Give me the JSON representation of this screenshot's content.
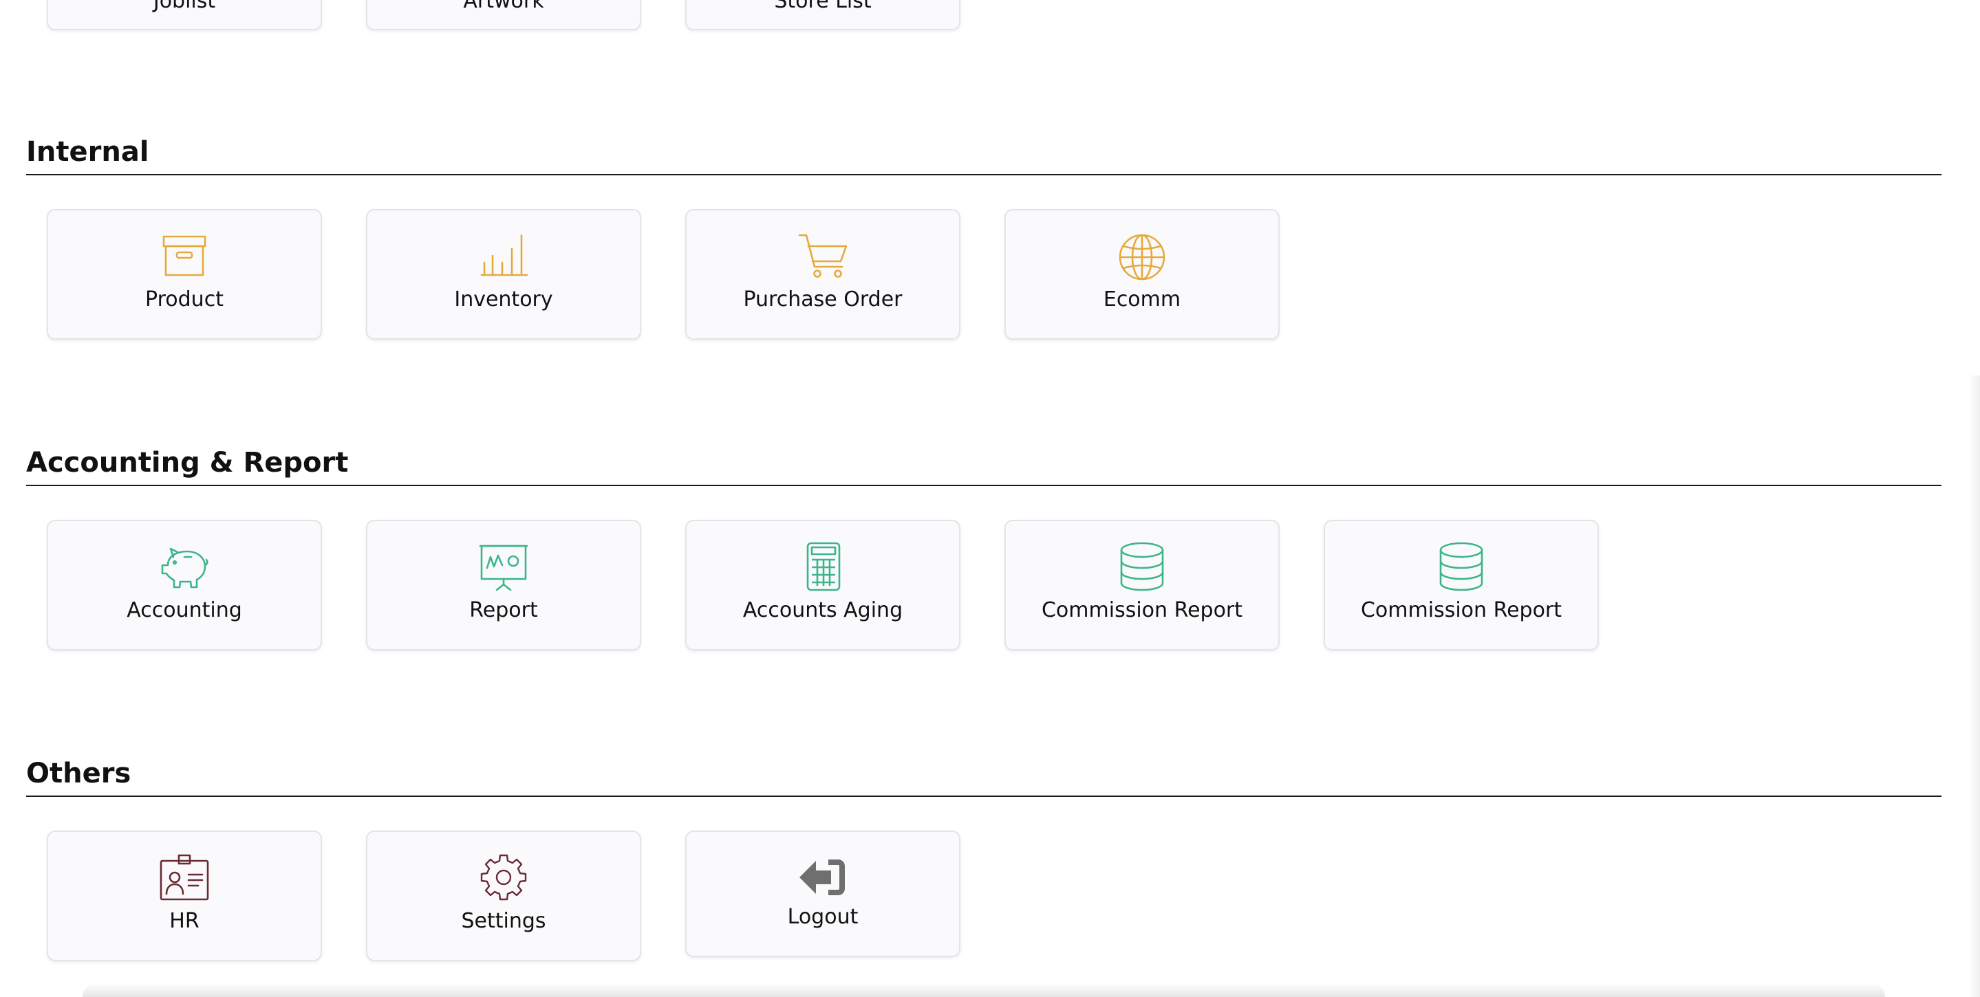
{
  "top_row": {
    "items": [
      {
        "label": "Joblist"
      },
      {
        "label": "Artwork"
      },
      {
        "label": "Store List"
      }
    ]
  },
  "sections": [
    {
      "title": "Internal",
      "accent": "#e8a93c",
      "items": [
        {
          "label": "Product",
          "icon": "archive-box-icon"
        },
        {
          "label": "Inventory",
          "icon": "bar-chart-icon"
        },
        {
          "label": "Purchase Order",
          "icon": "shopping-cart-icon"
        },
        {
          "label": "Ecomm",
          "icon": "globe-icon"
        }
      ]
    },
    {
      "title": "Accounting & Report",
      "accent": "#3bb58a",
      "items": [
        {
          "label": "Accounting",
          "icon": "piggy-bank-icon"
        },
        {
          "label": "Report",
          "icon": "presentation-board-icon"
        },
        {
          "label": "Accounts Aging",
          "icon": "calculator-icon"
        },
        {
          "label": "Commission Report",
          "icon": "coin-stack-icon"
        },
        {
          "label": "Commission Report",
          "icon": "coin-stack-icon"
        }
      ]
    },
    {
      "title": "Others",
      "accent": "#6b2a33",
      "items": [
        {
          "label": "HR",
          "icon": "id-badge-icon"
        },
        {
          "label": "Settings",
          "icon": "gear-icon"
        },
        {
          "label": "Logout",
          "icon": "logout-icon"
        }
      ]
    }
  ],
  "colors": {
    "logout_icon": "#6f6f6f",
    "tile_background": "#fafafd",
    "tile_border": "#e3e3ea"
  }
}
